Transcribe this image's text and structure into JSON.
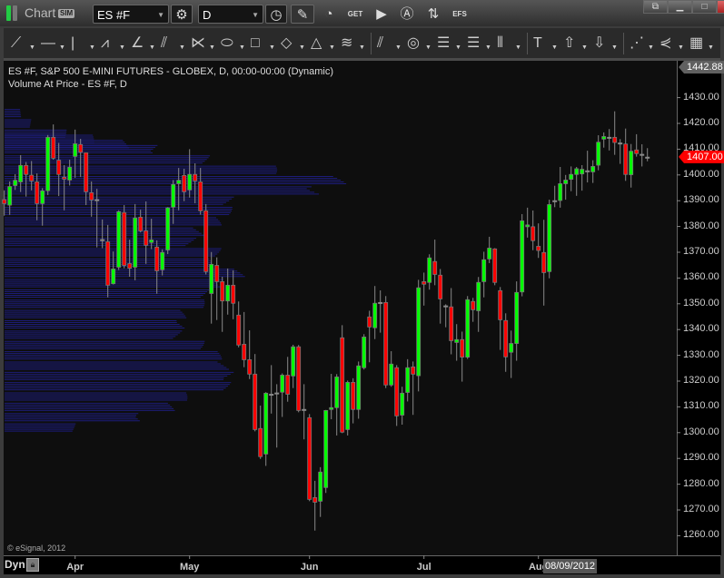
{
  "titlebar": {
    "title": "Chart",
    "sim_badge": "SIM",
    "symbol": "ES #F",
    "interval": "D",
    "efs_label": "EFS",
    "get_label": "GET",
    "link_colors": [
      "#22cc44",
      "#777777"
    ]
  },
  "toolbar_icons": [
    {
      "name": "line-tool-icon",
      "glyph": "⟋"
    },
    {
      "name": "horizontal-line-icon",
      "glyph": "—"
    },
    {
      "name": "vertical-line-icon",
      "glyph": "|"
    },
    {
      "name": "zigzag-icon",
      "glyph": "⩘"
    },
    {
      "name": "gann-fan-icon",
      "glyph": "∠"
    },
    {
      "name": "pitchfork-icon",
      "glyph": "⫽"
    },
    {
      "name": "fib-fan-icon",
      "glyph": "⋉"
    },
    {
      "name": "ellipse-icon",
      "glyph": "⬭"
    },
    {
      "name": "rectangle-icon",
      "glyph": "□"
    },
    {
      "name": "rotated-rectangle-icon",
      "glyph": "◇"
    },
    {
      "name": "triangle-icon",
      "glyph": "△"
    },
    {
      "name": "channel-icon",
      "glyph": "≋"
    },
    {
      "name": "parallel-lines-icon",
      "glyph": "⫽"
    },
    {
      "name": "circles-icon",
      "glyph": "◎"
    },
    {
      "name": "fib-retracement-icon",
      "glyph": "☰"
    },
    {
      "name": "fib-extension-icon",
      "glyph": "☰"
    },
    {
      "name": "time-cycles-icon",
      "glyph": "⦀"
    },
    {
      "name": "text-tool-icon",
      "glyph": "T"
    },
    {
      "name": "arrow-up-icon",
      "glyph": "⇧"
    },
    {
      "name": "arrow-down-icon",
      "glyph": "⇩"
    },
    {
      "name": "regression-icon",
      "glyph": "⋰"
    },
    {
      "name": "speed-lines-icon",
      "glyph": "⋞"
    },
    {
      "name": "grid-tool-icon",
      "glyph": "▦"
    }
  ],
  "legend": {
    "line1": "ES #F, S&P 500 E-MINI FUTURES - GLOBEX, D, 00:00-00:00 (Dynamic)",
    "line2": "Volume At Price - ES #F, D"
  },
  "copyright": "© eSignal, 2012",
  "footer": {
    "mode_label": "Dyn",
    "crosshair_date": "08/09/2012"
  },
  "colors": {
    "up": "#00ff00",
    "down": "#ff0000",
    "last_price_tag": "#ff0000",
    "high_tag": "#606060",
    "volume_profile": "#1c1c78"
  },
  "chart_data": {
    "type": "candlestick",
    "ylim": [
      1250,
      1445
    ],
    "y_ticks": [
      1260,
      1270,
      1280,
      1290,
      1300,
      1310,
      1320,
      1330,
      1340,
      1350,
      1360,
      1370,
      1380,
      1390,
      1400,
      1410,
      1420,
      1430
    ],
    "y_tick_format": "0.00",
    "x_month_labels": [
      {
        "label": "Apr",
        "bar_index": 13
      },
      {
        "label": "May",
        "bar_index": 34
      },
      {
        "label": "Jun",
        "bar_index": 56
      },
      {
        "label": "Jul",
        "bar_index": 77
      },
      {
        "label": "Aug",
        "bar_index": 98
      }
    ],
    "high_price_tag": "1442.88",
    "last_price_tag": "1407.00",
    "last_price": 1407.0,
    "ohlc_fields": [
      "open",
      "high",
      "low",
      "close"
    ],
    "ohlc": [
      [
        1390.4,
        1394,
        1384.2,
        1388.9
      ],
      [
        1388.3,
        1397.5,
        1384.5,
        1395.5
      ],
      [
        1395.9,
        1400.3,
        1394.2,
        1397.9
      ],
      [
        1397.3,
        1407.7,
        1393.4,
        1403.7
      ],
      [
        1403.7,
        1405,
        1391.6,
        1400.2
      ],
      [
        1399.9,
        1405.4,
        1394,
        1397.7
      ],
      [
        1397.3,
        1400.6,
        1382.4,
        1388.9
      ],
      [
        1388.9,
        1394.9,
        1380.3,
        1393.8
      ],
      [
        1393.9,
        1415.5,
        1392.2,
        1414.6
      ],
      [
        1414.6,
        1419.6,
        1405.9,
        1406.5
      ],
      [
        1405.7,
        1412.4,
        1391.8,
        1400.2
      ],
      [
        1399.1,
        1403.8,
        1386.3,
        1398.4
      ],
      [
        1398.0,
        1405.9,
        1395.9,
        1403.0
      ],
      [
        1407.2,
        1417.6,
        1398.9,
        1412.1
      ],
      [
        1411.8,
        1414,
        1399.2,
        1408.8
      ],
      [
        1408.6,
        1408.6,
        1388.3,
        1393.5
      ],
      [
        1393.1,
        1397.5,
        1383.8,
        1390.3
      ],
      [
        1390.2,
        1394.6,
        1371.9,
        1390.2
      ],
      [
        1374.7,
        1382.7,
        1371.6,
        1374.7
      ],
      [
        1374.1,
        1380.6,
        1352.5,
        1357.2
      ],
      [
        1357.8,
        1370.3,
        1357.5,
        1363.5
      ],
      [
        1364.2,
        1386.3,
        1363.1,
        1385.7
      ],
      [
        1385.4,
        1388.3,
        1363.8,
        1364.9
      ],
      [
        1365.6,
        1374.9,
        1360.5,
        1363.8
      ],
      [
        1364.2,
        1388.7,
        1359.1,
        1383.3
      ],
      [
        1383.6,
        1386.5,
        1377.7,
        1378.3
      ],
      [
        1378.3,
        1389.7,
        1365.5,
        1372.7
      ],
      [
        1373.8,
        1383,
        1371.2,
        1374.8
      ],
      [
        1372,
        1374.6,
        1353.9,
        1362.8
      ],
      [
        1363.2,
        1371.1,
        1361,
        1369.9
      ],
      [
        1370.9,
        1387.5,
        1369.3,
        1387.2
      ],
      [
        1387.5,
        1398,
        1381,
        1396.3
      ],
      [
        1396.6,
        1402.7,
        1386.3,
        1397.9
      ],
      [
        1399.8,
        1402.4,
        1389.8,
        1393.5
      ],
      [
        1394.2,
        1410,
        1391.2,
        1400.2
      ],
      [
        1400.2,
        1404.5,
        1389,
        1397.7
      ],
      [
        1397.3,
        1402.7,
        1384.6,
        1386.1
      ],
      [
        1386.1,
        1388.7,
        1361.4,
        1362.5
      ],
      [
        1354.0,
        1370.1,
        1342.3,
        1365.3
      ],
      [
        1364.9,
        1368,
        1343.7,
        1358.6
      ],
      [
        1358.6,
        1360.5,
        1339.1,
        1351.1
      ],
      [
        1351.1,
        1363.7,
        1345.8,
        1357.2
      ],
      [
        1357.2,
        1363,
        1344,
        1350.2
      ],
      [
        1345.6,
        1350.9,
        1333.1,
        1334
      ],
      [
        1334.3,
        1346.8,
        1325.4,
        1328.3
      ],
      [
        1328.3,
        1339.7,
        1320.8,
        1322.7
      ],
      [
        1322.7,
        1330.5,
        1300.5,
        1301.2
      ],
      [
        1301.6,
        1310.5,
        1289.8,
        1290.7
      ],
      [
        1291.7,
        1315.7,
        1287.1,
        1315.3
      ],
      [
        1314.7,
        1326.2,
        1307.4,
        1314.7
      ],
      [
        1315.2,
        1318.8,
        1294.2,
        1315.2
      ],
      [
        1315.7,
        1323,
        1306.1,
        1322.3
      ],
      [
        1322.3,
        1329.4,
        1312,
        1314.9
      ],
      [
        1322,
        1334.1,
        1317.3,
        1333.3
      ],
      [
        1333.3,
        1334,
        1307.9,
        1308.6
      ],
      [
        1308.8,
        1318.8,
        1297.4,
        1308.8
      ],
      [
        1305.8,
        1307.2,
        1273.4,
        1274.1
      ],
      [
        1274.8,
        1281.3,
        1262,
        1273
      ],
      [
        1273.4,
        1286.6,
        1267.3,
        1284.7
      ],
      [
        1278.7,
        1308.8,
        1276.6,
        1308.6
      ],
      [
        1309,
        1322.8,
        1305.2,
        1309.7
      ],
      [
        1309.7,
        1322.7,
        1298.9,
        1321.6
      ],
      [
        1336.8,
        1341.7,
        1299.8,
        1300.2
      ],
      [
        1301.2,
        1320.2,
        1298.9,
        1319.5
      ],
      [
        1319.5,
        1321.1,
        1303.6,
        1309
      ],
      [
        1309,
        1327.6,
        1305.4,
        1325.9
      ],
      [
        1325.2,
        1338.2,
        1324.5,
        1337.1
      ],
      [
        1344.9,
        1347.3,
        1327.3,
        1341
      ],
      [
        1340.7,
        1356.9,
        1336.3,
        1350.2
      ],
      [
        1350.3,
        1355.2,
        1338.8,
        1350.3
      ],
      [
        1350.5,
        1353,
        1317.3,
        1318.5
      ],
      [
        1318.5,
        1331.6,
        1317.8,
        1326.6
      ],
      [
        1325.2,
        1326.2,
        1302.6,
        1306.5
      ],
      [
        1306.8,
        1317.8,
        1303.1,
        1315.3
      ],
      [
        1315.6,
        1328.5,
        1312.1,
        1325.2
      ],
      [
        1325.5,
        1327.6,
        1306.9,
        1322.7
      ],
      [
        1322.1,
        1359.3,
        1316,
        1356.2
      ],
      [
        1358.6,
        1362.1,
        1349.3,
        1357.6
      ],
      [
        1358.3,
        1369.2,
        1355.5,
        1367.8
      ],
      [
        1366.4,
        1374.9,
        1357.2,
        1361.4
      ],
      [
        1361.1,
        1363.5,
        1342.3,
        1351.9
      ],
      [
        1349,
        1349.8,
        1340.9,
        1349
      ],
      [
        1348.8,
        1356.1,
        1330.4,
        1335.7
      ],
      [
        1335,
        1342.1,
        1327.9,
        1336.1
      ],
      [
        1336.1,
        1339.2,
        1319.8,
        1329.3
      ],
      [
        1329.3,
        1353,
        1328.6,
        1351.6
      ],
      [
        1350.9,
        1352.3,
        1343,
        1347.7
      ],
      [
        1347.3,
        1360.4,
        1339.1,
        1358.3
      ],
      [
        1358.6,
        1370.2,
        1352.5,
        1367.1
      ],
      [
        1367.4,
        1376,
        1365.8,
        1371.6
      ],
      [
        1371.3,
        1371.6,
        1357.2,
        1358.3
      ],
      [
        1355.1,
        1356.5,
        1332.1,
        1343.8
      ],
      [
        1343.5,
        1346.3,
        1323.6,
        1329.4
      ],
      [
        1331.2,
        1339.6,
        1321.2,
        1334.6
      ],
      [
        1334.6,
        1358.7,
        1327.9,
        1354.4
      ],
      [
        1354.6,
        1384.8,
        1352.9,
        1382.2
      ],
      [
        1379.9,
        1387.3,
        1375.7,
        1380.6
      ],
      [
        1379.9,
        1386.2,
        1370.8,
        1374.5
      ],
      [
        1372.3,
        1381.2,
        1367.8,
        1370.7
      ],
      [
        1369.9,
        1382.6,
        1349.3,
        1362.1
      ],
      [
        1362.5,
        1390.4,
        1359.9,
        1388.5
      ],
      [
        1389.8,
        1395.8,
        1387.5,
        1389.8
      ],
      [
        1390.1,
        1403.1,
        1387.3,
        1396.6
      ],
      [
        1396.6,
        1400,
        1390.4,
        1398
      ],
      [
        1398.3,
        1403.3,
        1393.7,
        1400.2
      ],
      [
        1400.2,
        1403.1,
        1391.9,
        1402.4
      ],
      [
        1400.4,
        1403.8,
        1393.9,
        1402.2
      ],
      [
        1401.4,
        1409.4,
        1397.1,
        1401.4
      ],
      [
        1401.2,
        1405.7,
        1396.9,
        1403.3
      ],
      [
        1403.8,
        1415.4,
        1401.8,
        1412.7
      ],
      [
        1413.9,
        1416.5,
        1410.6,
        1414.9
      ],
      [
        1414.4,
        1417.8,
        1409.5,
        1414.4
      ],
      [
        1414.6,
        1424.7,
        1407.8,
        1412.6
      ],
      [
        1412.2,
        1413.9,
        1404.3,
        1412.2
      ],
      [
        1412,
        1418,
        1397.7,
        1400.2
      ],
      [
        1400.1,
        1412,
        1395.1,
        1409.2
      ],
      [
        1409.7,
        1415.8,
        1407.1,
        1408.3
      ],
      [
        1407.8,
        1411.9,
        1403.3,
        1407.8
      ],
      [
        1406.7,
        1410.4,
        1405.3,
        1406.7
      ]
    ],
    "volume_at_price": {
      "relative_volume_percent": true,
      "levels": [
        [
          1424,
          5
        ],
        [
          1420,
          8
        ],
        [
          1416,
          18
        ],
        [
          1414,
          26
        ],
        [
          1412,
          37
        ],
        [
          1410,
          47
        ],
        [
          1406,
          60
        ],
        [
          1402,
          79
        ],
        [
          1398,
          100
        ],
        [
          1394,
          97
        ],
        [
          1390,
          68
        ],
        [
          1386,
          66
        ],
        [
          1382,
          63
        ],
        [
          1378,
          60
        ],
        [
          1374,
          58
        ],
        [
          1370,
          63
        ],
        [
          1366,
          60
        ],
        [
          1362,
          71
        ],
        [
          1358,
          68
        ],
        [
          1354,
          60
        ],
        [
          1350,
          58
        ],
        [
          1346,
          53
        ],
        [
          1342,
          55
        ],
        [
          1338,
          53
        ],
        [
          1334,
          58
        ],
        [
          1330,
          63
        ],
        [
          1326,
          67
        ],
        [
          1322,
          70
        ],
        [
          1318,
          66
        ],
        [
          1314,
          53
        ],
        [
          1310,
          50
        ],
        [
          1306,
          42
        ],
        [
          1302,
          21
        ]
      ]
    }
  }
}
